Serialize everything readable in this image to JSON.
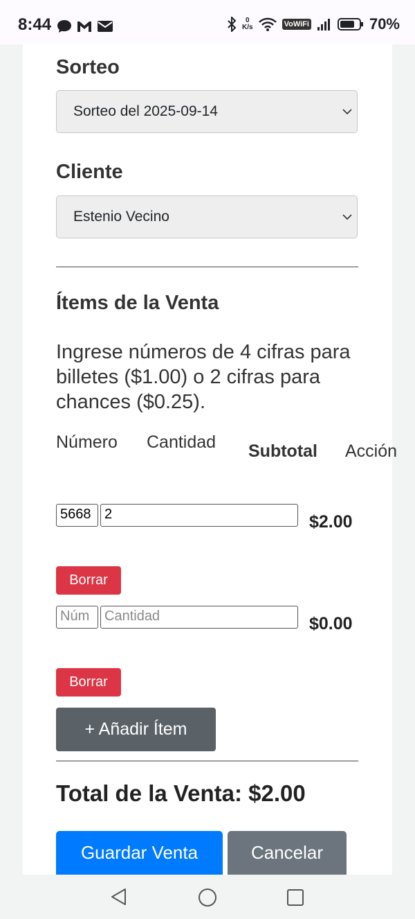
{
  "status_bar": {
    "time": "8:44",
    "battery": "70%",
    "vowifi": "VoWiFi",
    "speed_value": "0",
    "speed_unit": "K/s"
  },
  "form": {
    "sorteo_label": "Sorteo",
    "sorteo_value": "Sorteo del 2025-09-14",
    "cliente_label": "Cliente",
    "cliente_value": "Estenio Vecino"
  },
  "items": {
    "title": "Ítems de la Venta",
    "description": "Ingrese números de 4 cifras para billetes ($1.00) o 2 cifras para chances ($0.25).",
    "headers": {
      "numero": "Número",
      "cantidad": "Cantidad",
      "subtotal": "Subtotal",
      "accion": "Acción"
    },
    "rows": [
      {
        "numero": "5668",
        "cantidad": "2",
        "numero_placeholder": "",
        "cantidad_placeholder": "",
        "subtotal": "$2.00",
        "delete_label": "Borrar"
      },
      {
        "numero": "",
        "cantidad": "",
        "numero_placeholder": "Núm",
        "cantidad_placeholder": "Cantidad",
        "subtotal": "$0.00",
        "delete_label": "Borrar"
      }
    ],
    "add_label": "+ Añadir Ítem"
  },
  "total_label": "Total de la Venta: $2.00",
  "actions": {
    "save_label": "Guardar Venta",
    "cancel_label": "Cancelar"
  }
}
